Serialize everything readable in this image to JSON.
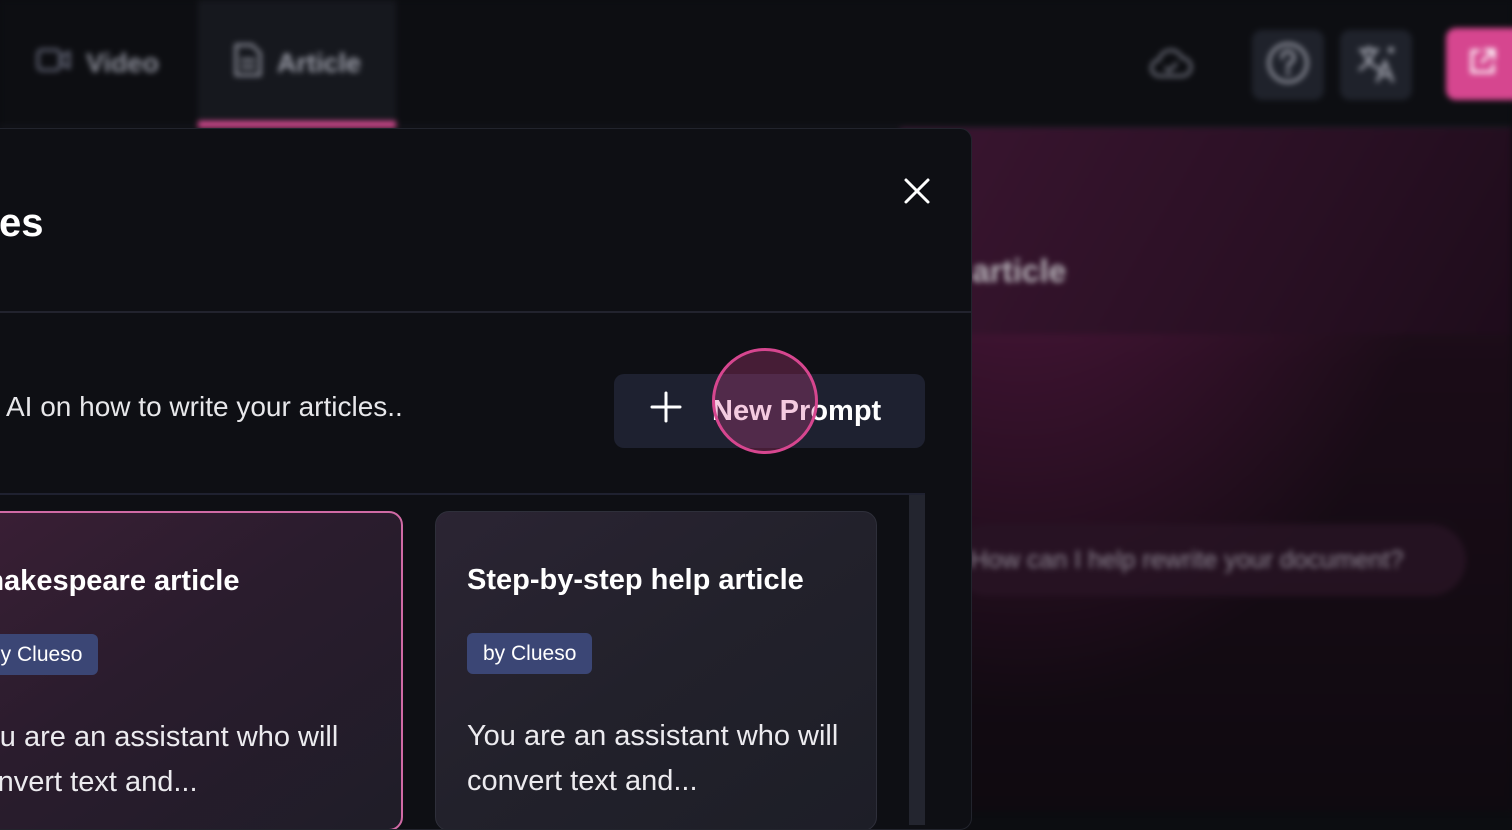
{
  "topbar": {
    "tabs": [
      {
        "label": "Video",
        "icon": "video-camera-icon"
      },
      {
        "label": "Article",
        "icon": "document-icon",
        "active": true
      }
    ],
    "icons": [
      "cloud-icon",
      "help-icon",
      "translate-icon",
      "export-icon"
    ]
  },
  "ai_panel": {
    "title": "article",
    "input_placeholder": "How can I help rewrite your document?"
  },
  "modal": {
    "title": "es",
    "description": "AI on how to write your articles..",
    "new_prompt_label": "New Prompt",
    "cards": [
      {
        "title": "Shakespeare article",
        "badge": "by Clueso",
        "text": "You are an assistant who will convert text and..."
      },
      {
        "title": "Step-by-step help article",
        "badge": "by Clueso",
        "text": "You are an assistant who will convert text and..."
      }
    ]
  },
  "colors": {
    "accent": "#d6468f",
    "badge": "#3b4675",
    "modal_bg": "#0e0f14",
    "button_bg": "#1e2130"
  }
}
